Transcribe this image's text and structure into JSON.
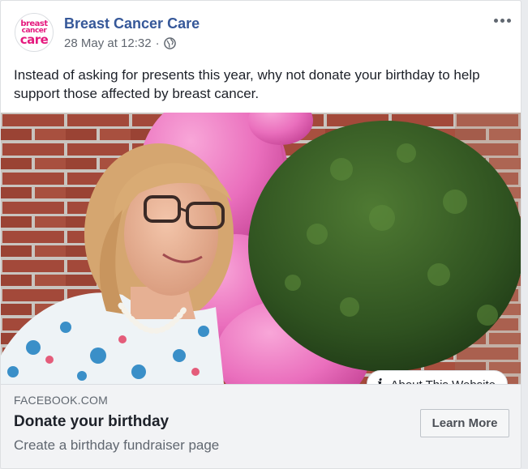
{
  "post": {
    "page_name": "Breast Cancer Care",
    "avatar_lines": [
      "breast",
      "cancer",
      "care"
    ],
    "timestamp": "28 May at 12:32",
    "separator": "·",
    "privacy_icon": "globe-icon",
    "menu_icon": "more-options-icon",
    "text": "Instead of asking for presents this year, why not donate your birthday to help support those affected by breast cancer."
  },
  "media": {
    "description_icon": "photo",
    "about_label": "About This Website",
    "about_icon": "info-icon"
  },
  "link": {
    "domain": "FACEBOOK.COM",
    "headline": "Donate your birthday",
    "description": "Create a birthday fundraiser page",
    "cta_label": "Learn More"
  },
  "colors": {
    "brand_pink": "#e5197e",
    "page_name_blue": "#365899",
    "text": "#1d2129",
    "meta_gray": "#616770",
    "link_box_bg": "#f2f3f5"
  }
}
